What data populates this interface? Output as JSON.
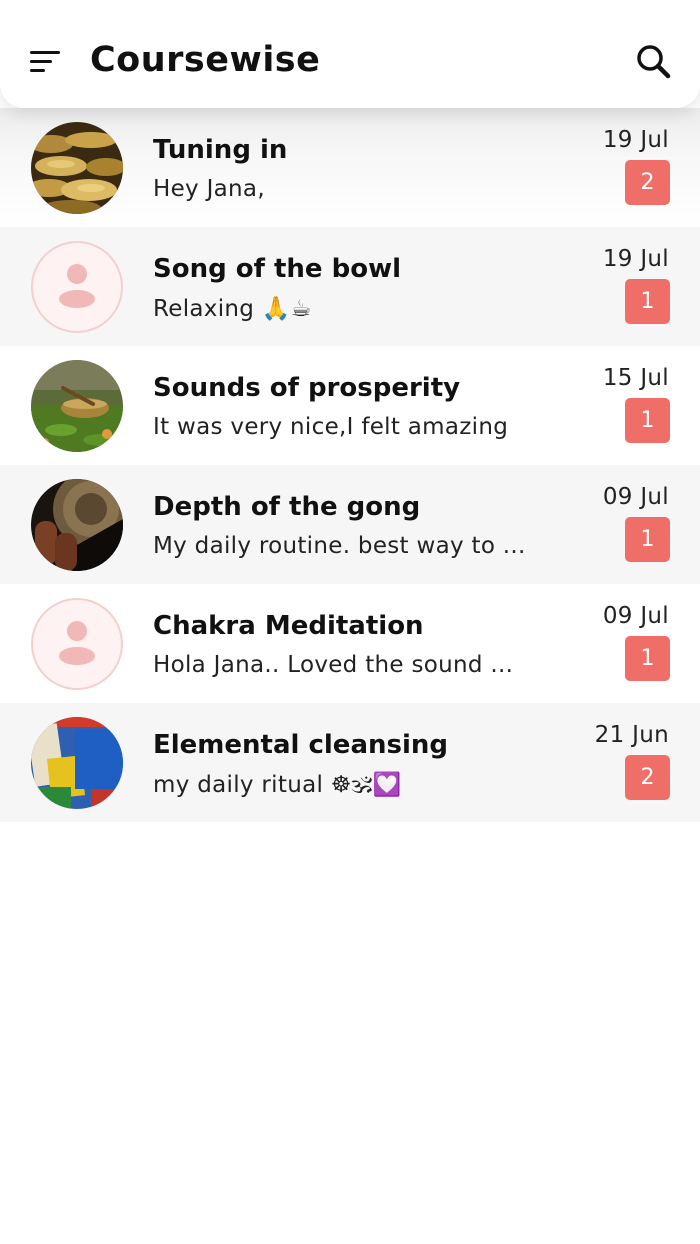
{
  "app": {
    "title": "Coursewise"
  },
  "colors": {
    "badge": "#ef6f68",
    "placeholder_avatar_bg": "#fff2f2",
    "placeholder_avatar_fg": "#f0b8b6"
  },
  "conversations": [
    {
      "title": "Tuning in",
      "preview": "Hey Jana,",
      "date": "19 Jul",
      "unread": "2",
      "avatar": "singing-bowls-photo"
    },
    {
      "title": "Song of the bowl",
      "preview": "Relaxing 🙏☕",
      "date": "19 Jul",
      "unread": "1",
      "avatar": "person-placeholder-icon"
    },
    {
      "title": "Sounds of prosperity",
      "preview": "It was very nice,I felt amazing",
      "date": "15 Jul",
      "unread": "1",
      "avatar": "bowl-on-grass-photo"
    },
    {
      "title": "Depth of the gong",
      "preview": "My daily routine. best way to ...",
      "date": "09 Jul",
      "unread": "1",
      "avatar": "gong-mallets-photo"
    },
    {
      "title": "Chakra Meditation",
      "preview": "Hola Jana.. Loved the sound ...",
      "date": "09 Jul",
      "unread": "1",
      "avatar": "person-placeholder-icon"
    },
    {
      "title": "Elemental cleansing",
      "preview": "my daily ritual ☸🕉💟",
      "date": "21 Jun",
      "unread": "2",
      "avatar": "prayer-flags-photo"
    }
  ]
}
